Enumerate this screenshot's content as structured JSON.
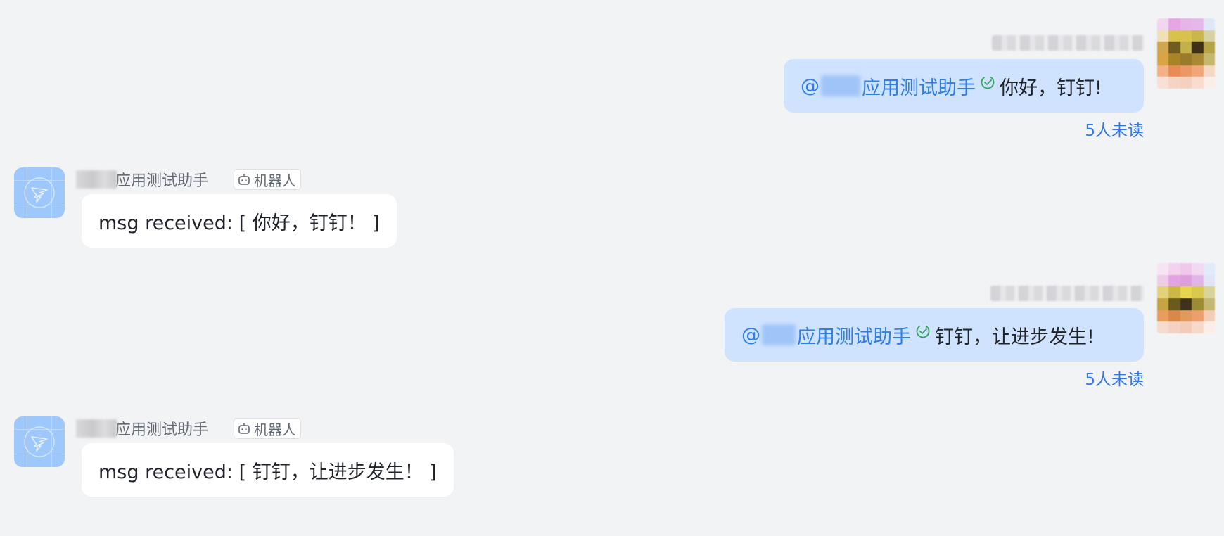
{
  "colors": {
    "background": "#f2f3f5",
    "outgoing_bubble": "#cfe3fe",
    "incoming_bubble": "#ffffff",
    "mention": "#2f7de6",
    "unread": "#3277e8",
    "read_check": "#2fa55a"
  },
  "messages": [
    {
      "direction": "outgoing",
      "mention_prefix": "@",
      "mention_name": "应用测试助手",
      "text": "你好，钉钉!",
      "unread_label": "5人未读"
    },
    {
      "direction": "incoming",
      "sender_name": "应用测试助手",
      "badge_label": "机器人",
      "text": "msg received: [ 你好，钉钉！ ]"
    },
    {
      "direction": "outgoing",
      "mention_prefix": "@",
      "mention_name": "应用测试助手",
      "text": "钉钉，让进步发生!",
      "unread_label": "5人未读"
    },
    {
      "direction": "incoming",
      "sender_name": "应用测试助手",
      "badge_label": "机器人",
      "text": "msg received: [ 钉钉，让进步发生！ ]"
    }
  ]
}
